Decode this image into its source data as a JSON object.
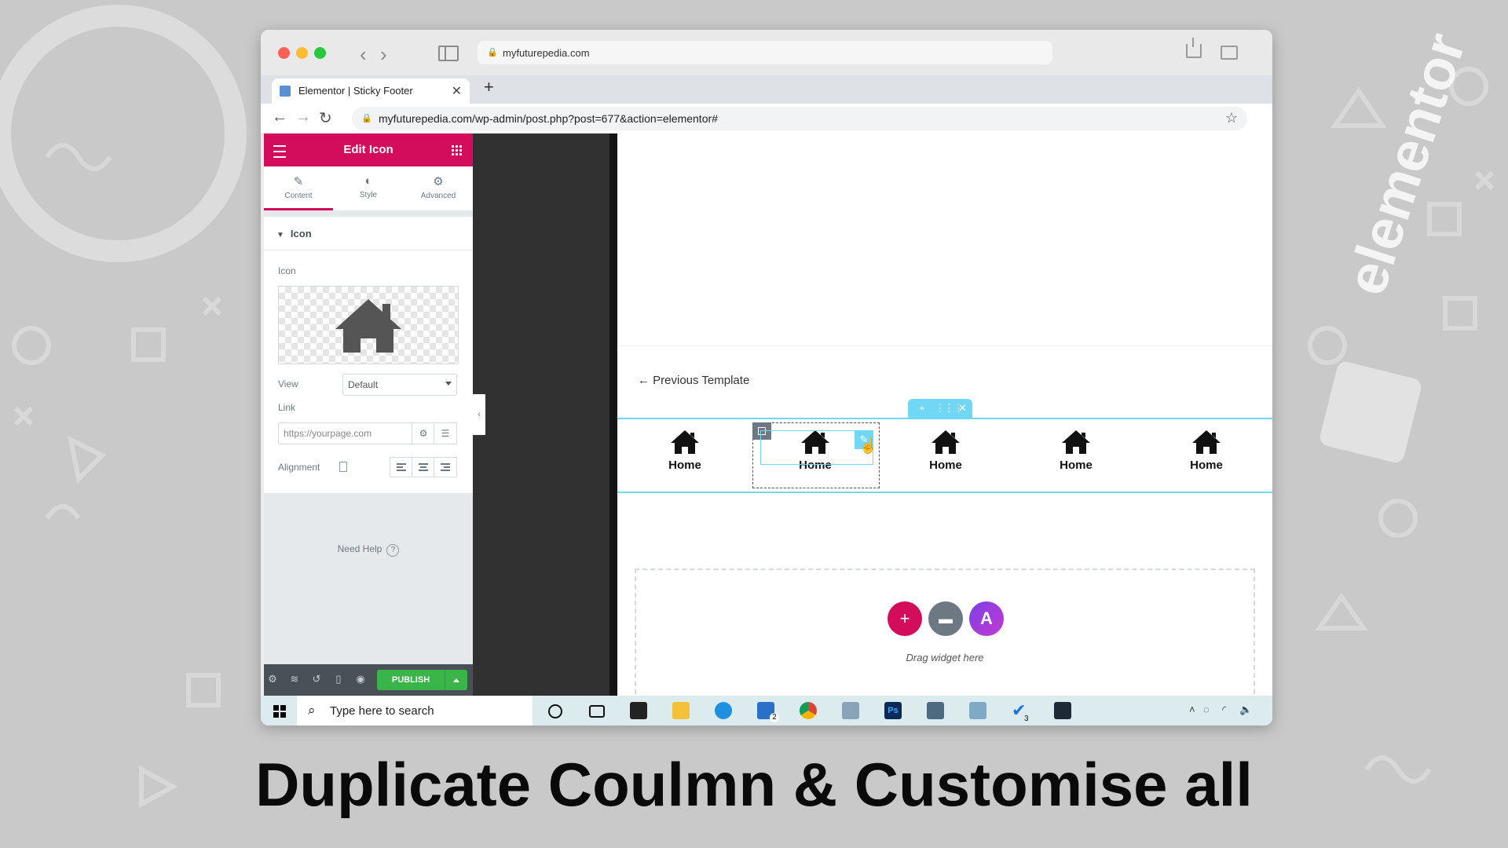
{
  "browser": {
    "mac_url": "myfuturepedia.com",
    "tab_title": "Elementor | Sticky Footer",
    "tab_close": "✕",
    "new_tab": "+",
    "address": "myfuturepedia.com/wp-admin/post.php?post=677&action=elementor#"
  },
  "panel": {
    "title": "Edit Icon",
    "tabs": [
      {
        "label": "Content",
        "icon": "pencil-icon"
      },
      {
        "label": "Style",
        "icon": "half-circle-icon"
      },
      {
        "label": "Advanced",
        "icon": "gear-icon"
      }
    ],
    "section_title": "Icon",
    "icon_label": "Icon",
    "view_label": "View",
    "view_value": "Default",
    "link_label": "Link",
    "link_placeholder": "https://yourpage.com",
    "alignment_label": "Alignment",
    "need_help": "Need Help",
    "help_mark": "?",
    "publish": "PUBLISH"
  },
  "canvas": {
    "previous_template": "← Previous Template",
    "columns": [
      {
        "label": "Home",
        "icon": "home-icon"
      },
      {
        "label": "Home",
        "icon": "home-icon"
      },
      {
        "label": "Home",
        "icon": "home-icon"
      },
      {
        "label": "Home",
        "icon": "home-icon"
      },
      {
        "label": "Home",
        "icon": "home-icon"
      }
    ],
    "drag_widget": "Drag widget here"
  },
  "taskbar": {
    "search_placeholder": "Type here to search",
    "mail_badge": "2",
    "check_badge": "3"
  },
  "caption": "Duplicate Coulmn & Customise all",
  "colors": {
    "elementor_pink": "#d30c5c",
    "selection_blue": "#71d7f7",
    "publish_green": "#39b54a",
    "panel_footer": "#495157"
  }
}
